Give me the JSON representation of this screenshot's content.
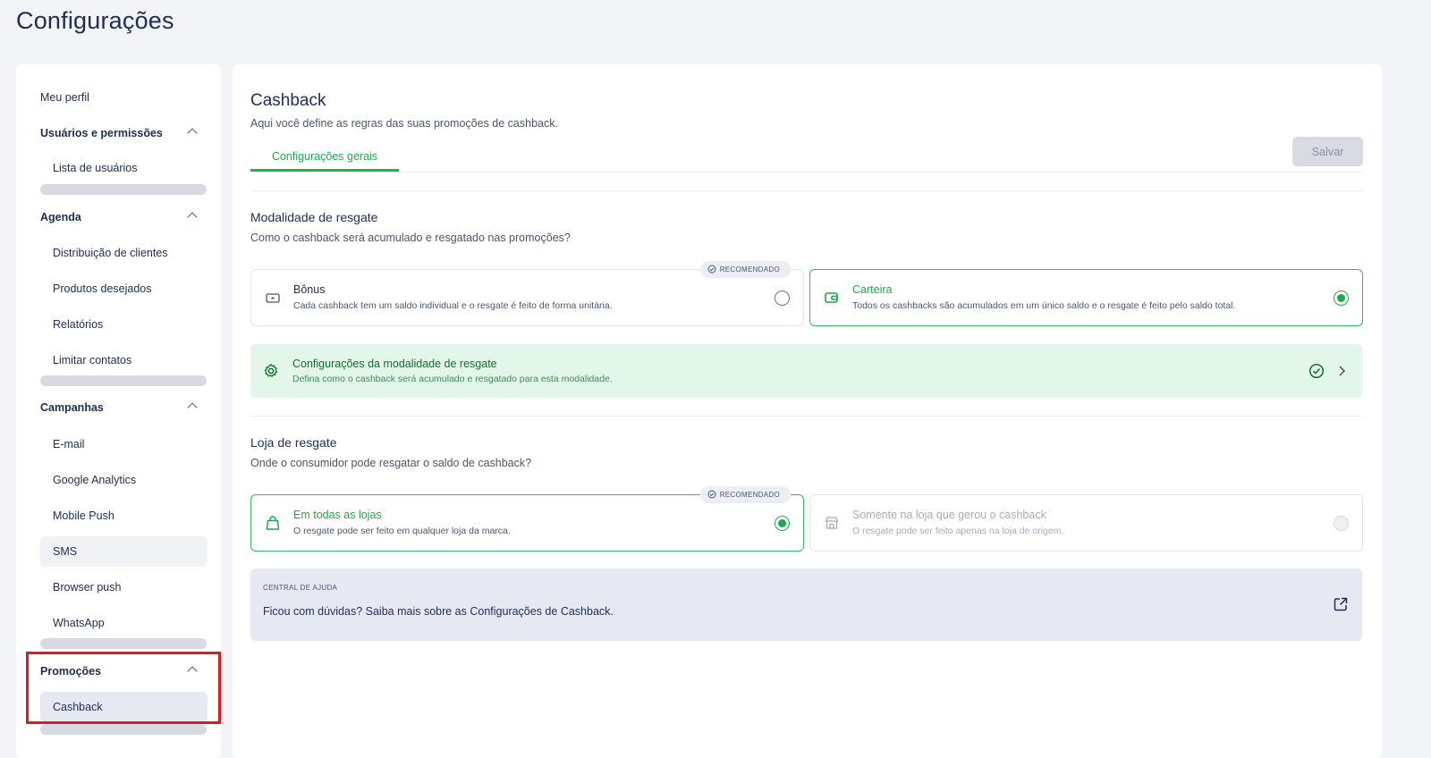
{
  "page": {
    "title": "Configurações"
  },
  "sidebar": {
    "profile": "Meu perfil",
    "groups": [
      {
        "label": "Usuários e permissões",
        "items": [
          "Lista de usuários"
        ]
      },
      {
        "label": "Agenda",
        "items": [
          "Distribuição de clientes",
          "Produtos desejados",
          "Relatórios",
          "Limitar contatos"
        ]
      },
      {
        "label": "Campanhas",
        "items": [
          "E-mail",
          "Google Analytics",
          "Mobile Push",
          "SMS",
          "Browser push",
          "WhatsApp"
        ]
      },
      {
        "label": "Promoções",
        "items": [
          "Cashback"
        ]
      }
    ]
  },
  "main": {
    "title": "Cashback",
    "subtitle": "Aqui você define as regras das suas promoções de cashback.",
    "tabs": [
      {
        "label": "Configurações gerais",
        "active": true
      }
    ],
    "save_label": "Salvar",
    "redemption_mode": {
      "title": "Modalidade de resgate",
      "subtitle": "Como o cashback será acumulado e resgatado nas promoções?",
      "badge": "RECOMENDADO",
      "options": [
        {
          "title": "Bônus",
          "desc": "Cada cashback tem um saldo individual e o resgate é feito de forma unitária.",
          "selected": false,
          "icon": "ticket-icon"
        },
        {
          "title": "Carteira",
          "desc": "Todos os cashbacks são acumulados em um único saldo e o resgate é feito pelo saldo total.",
          "selected": true,
          "icon": "wallet-icon"
        }
      ],
      "config": {
        "title": "Configurações da modalidade de resgate",
        "desc": "Defina como o cashback será acumulado e resgatado para esta modalidade."
      }
    },
    "redemption_store": {
      "title": "Loja de resgate",
      "subtitle": "Onde o consumidor pode resgatar o saldo de cashback?",
      "badge": "RECOMENDADO",
      "options": [
        {
          "title": "Em todas as lojas",
          "desc": "O resgate pode ser feito em qualquer loja da marca.",
          "selected": true,
          "icon": "shopping-bag-icon"
        },
        {
          "title": "Somente na loja que gerou o cashback",
          "desc": "O resgate pode ser feito apenas na loja de origem.",
          "selected": false,
          "disabled": true,
          "icon": "store-icon"
        }
      ]
    },
    "help": {
      "caption": "CENTRAL DE AJUDA",
      "text": "Ficou com dúvidas? Saiba mais sobre as Configurações de Cashback."
    }
  },
  "colors": {
    "accent": "#1ea84d",
    "annotation": "#e0191f",
    "title": "#1e2c57"
  }
}
